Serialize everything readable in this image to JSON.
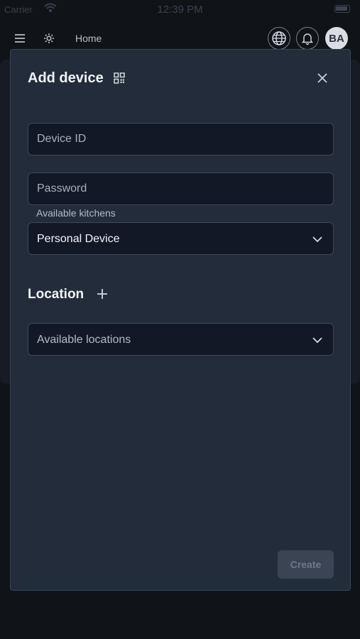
{
  "status_bar": {
    "carrier": "Carrier",
    "time": "12:39 PM"
  },
  "topbar": {
    "menu_icon": "hamburger-icon",
    "settings_icon": "gear-icon",
    "home_label": "Home",
    "globe_icon": "globe-icon",
    "bell_icon": "bell-icon",
    "avatar_initials": "BA"
  },
  "modal": {
    "title": "Add device",
    "qr_icon": "qr-code-icon",
    "close_icon": "close-icon",
    "device_id": {
      "value": "",
      "placeholder": "Device ID"
    },
    "password": {
      "value": "",
      "placeholder": "Password"
    },
    "kitchens_label": "Available kitchens",
    "kitchen_selected": "Personal Device",
    "location_heading": "Location",
    "add_location_icon": "plus-icon",
    "locations_placeholder": "Available locations",
    "create_label": "Create"
  },
  "colors": {
    "background": "#101318",
    "modal_bg": "#222c3a",
    "field_bg": "#131826",
    "button_disabled": "#3a4454"
  }
}
